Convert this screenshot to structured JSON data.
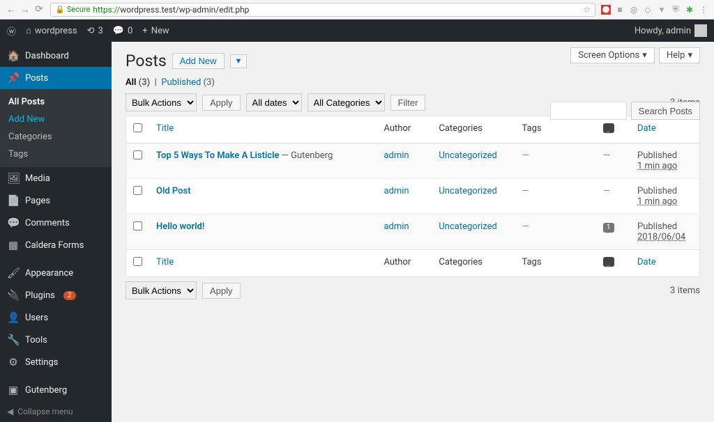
{
  "browser": {
    "secure_label": "Secure",
    "url_prefix": "https://",
    "url": "wordpress.test/wp-admin/edit.php"
  },
  "adminbar": {
    "site_name": "wordpress",
    "updates": "3",
    "comments": "0",
    "new_label": "New",
    "howdy": "Howdy, admin"
  },
  "sidebar": {
    "dashboard": "Dashboard",
    "posts": "Posts",
    "posts_sub": {
      "all": "All Posts",
      "add": "Add New",
      "categories": "Categories",
      "tags": "Tags"
    },
    "media": "Media",
    "pages": "Pages",
    "comments": "Comments",
    "caldera": "Caldera Forms",
    "appearance": "Appearance",
    "plugins": "Plugins",
    "plugins_badge": "2",
    "users": "Users",
    "tools": "Tools",
    "settings": "Settings",
    "gutenberg": "Gutenberg",
    "collapse": "Collapse menu"
  },
  "page": {
    "title": "Posts",
    "add_new": "Add New",
    "screen_options": "Screen Options",
    "help": "Help"
  },
  "filters": {
    "all_label": "All",
    "all_count": "(3)",
    "published_label": "Published",
    "published_count": "(3)",
    "bulk_actions": "Bulk Actions",
    "apply": "Apply",
    "all_dates": "All dates",
    "all_categories": "All Categories",
    "filter": "Filter",
    "items_count": "3 items",
    "search_btn": "Search Posts"
  },
  "table": {
    "headers": {
      "title": "Title",
      "author": "Author",
      "categories": "Categories",
      "tags": "Tags",
      "date": "Date"
    },
    "rows": [
      {
        "title": "Top 5 Ways To Make A Listicle",
        "state": "— Gutenberg",
        "author": "admin",
        "category": "Uncategorized",
        "tags": "—",
        "comments": "",
        "date_status": "Published",
        "date_time": "1 min ago"
      },
      {
        "title": "Old Post",
        "state": "",
        "author": "admin",
        "category": "Uncategorized",
        "tags": "—",
        "comments": "",
        "date_status": "Published",
        "date_time": "1 min ago"
      },
      {
        "title": "Hello world!",
        "state": "",
        "author": "admin",
        "category": "Uncategorized",
        "tags": "—",
        "comments": "1",
        "date_status": "Published",
        "date_time": "2018/06/04"
      }
    ]
  }
}
